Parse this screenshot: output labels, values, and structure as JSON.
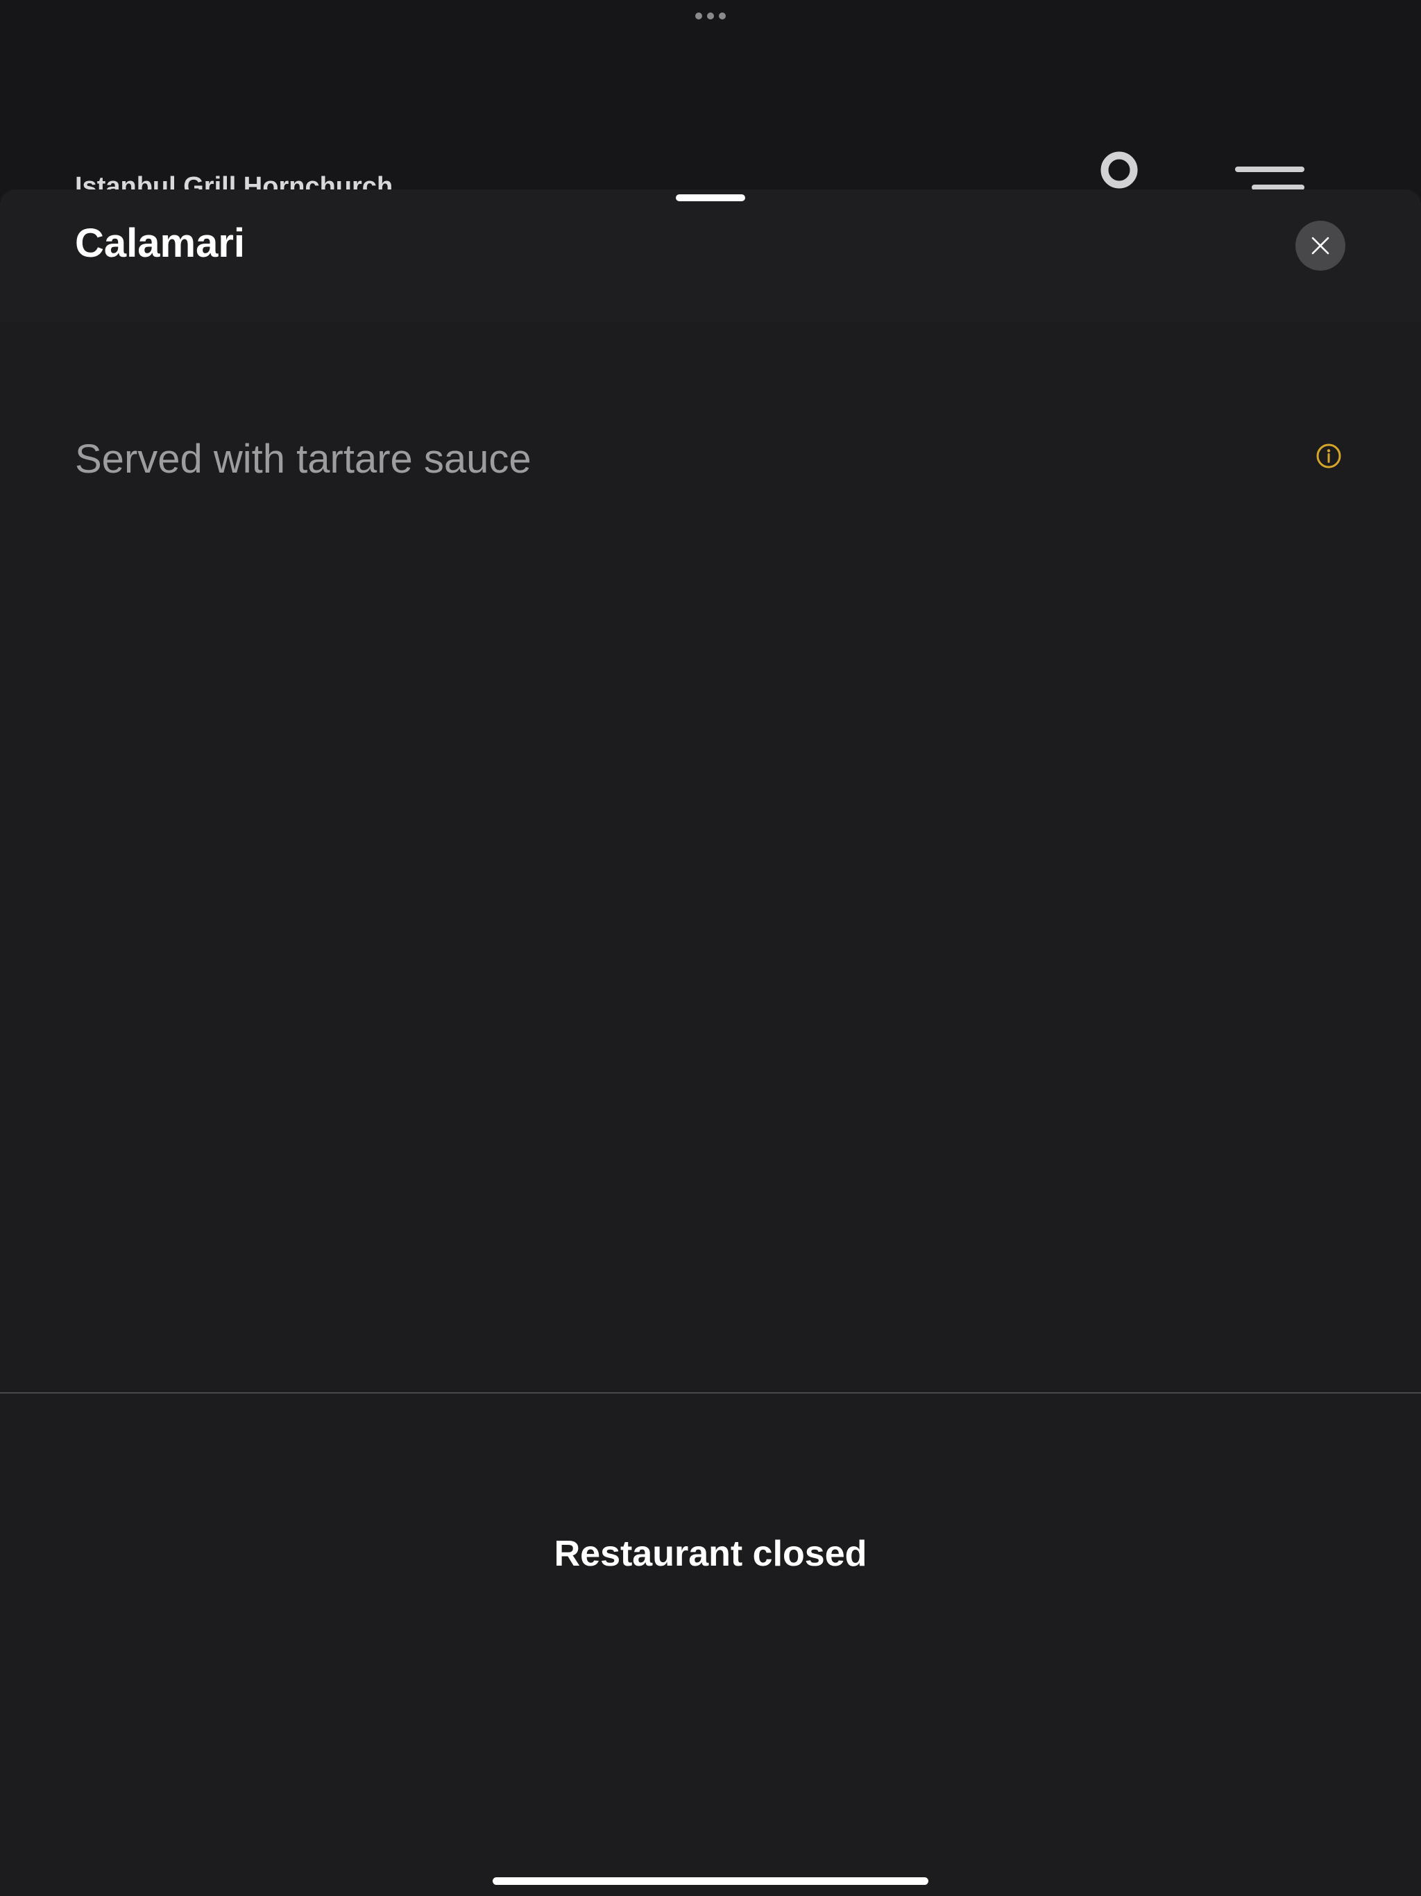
{
  "background_page": {
    "restaurant_name": "Istanbul Grill Hornchurch",
    "user_icon": "user-icon",
    "menu_icon": "menu-icon"
  },
  "item_sheet": {
    "title": "Calamari",
    "description": "Served with tartare sauce",
    "close_icon": "close-icon",
    "info_icon": "info-icon"
  },
  "footer": {
    "status": "Restaurant closed"
  },
  "colors": {
    "background": "#161517",
    "sheet": "#1c1b1d",
    "close_button": "#48474a",
    "description_text": "#9d9ca1",
    "info_accent": "#d6a62a",
    "divider": "#48474b"
  }
}
